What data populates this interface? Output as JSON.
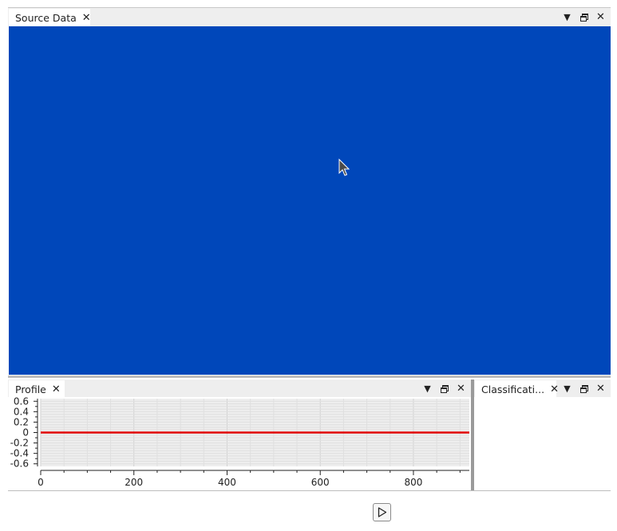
{
  "source_panel": {
    "tab_label": "Source Data",
    "canvas_color": "#0047ba",
    "cursor_icon": "mouse-pointer-icon"
  },
  "profile_panel": {
    "tab_label": "Profile"
  },
  "classification_panel": {
    "tab_label": "Classificati..."
  },
  "controls": {
    "menu_icon": "chevron-down-icon",
    "float_icon": "restore-window-icon",
    "close_icon": "close-icon",
    "close_glyph": "✕",
    "play_icon": "play-icon"
  },
  "chart_data": {
    "type": "line",
    "title": "",
    "xlabel": "",
    "ylabel": "",
    "xlim": [
      0,
      920
    ],
    "ylim": [
      -0.65,
      0.65
    ],
    "x_ticks": [
      0,
      200,
      400,
      600,
      800
    ],
    "y_ticks": [
      0.6,
      0.4,
      0.2,
      0,
      -0.2,
      -0.4,
      -0.6
    ],
    "x_tick_labels": [
      "0",
      "200",
      "400",
      "600",
      "800"
    ],
    "y_tick_labels": [
      "0.6",
      "0.4",
      "0.2",
      "0",
      "-0.2",
      "-0.4",
      "-0.6"
    ],
    "grid": true,
    "series": [
      {
        "color": "#e00000",
        "x": [
          0,
          920
        ],
        "y": [
          0,
          0
        ]
      }
    ]
  }
}
